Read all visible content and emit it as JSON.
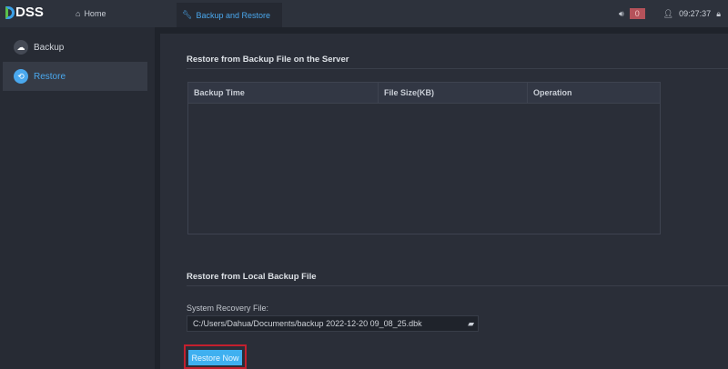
{
  "app": {
    "logo": "DSS",
    "home": "Home",
    "active_tab": "Backup and Restore",
    "alarm_count": "0",
    "time": "09:27:37"
  },
  "sidebar": {
    "items": [
      {
        "label": "Backup"
      },
      {
        "label": "Restore"
      }
    ]
  },
  "server": {
    "title": "Restore from Backup File on the Server",
    "columns": [
      "Backup Time",
      "File Size(KB)",
      "Operation"
    ],
    "rows": []
  },
  "local": {
    "title": "Restore from Local Backup File",
    "field_label": "System Recovery File:",
    "file_value": "C:/Users/Dahua/Documents/backup 2022-12-20 09_08_25.dbk",
    "button": "Restore Now"
  }
}
